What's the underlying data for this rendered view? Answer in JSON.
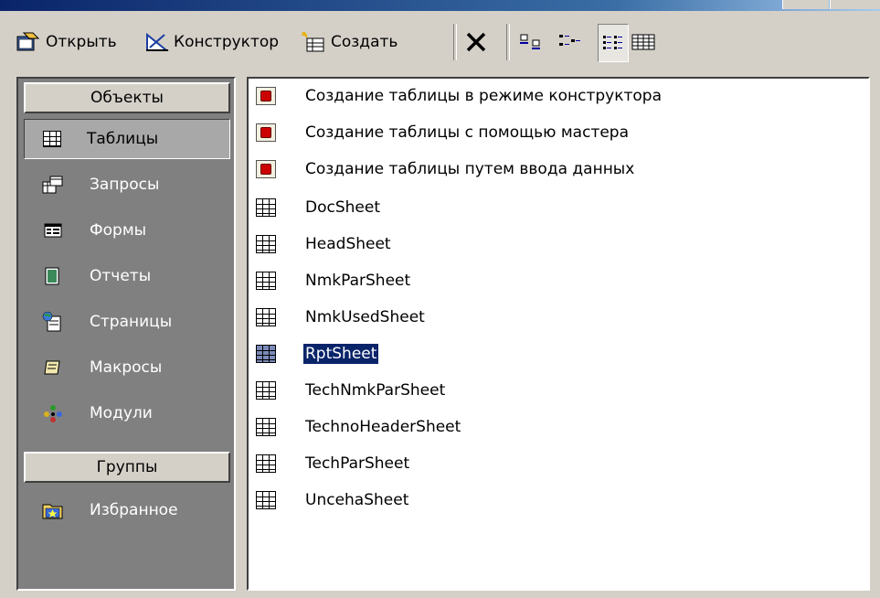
{
  "toolbar": {
    "open_label": "Открыть",
    "design_label": "Конструктор",
    "new_label": "Создать"
  },
  "objects_bar": {
    "objects_header": "Объекты",
    "items": [
      {
        "label": "Таблицы",
        "icon": "table-icon"
      },
      {
        "label": "Запросы",
        "icon": "query-icon"
      },
      {
        "label": "Формы",
        "icon": "form-icon"
      },
      {
        "label": "Отчеты",
        "icon": "report-icon"
      },
      {
        "label": "Страницы",
        "icon": "page-icon"
      },
      {
        "label": "Макросы",
        "icon": "macro-icon"
      },
      {
        "label": "Модули",
        "icon": "module-icon"
      }
    ],
    "groups_header": "Группы",
    "group_items": [
      {
        "label": "Избранное",
        "icon": "favorites-icon"
      }
    ]
  },
  "list": {
    "items": [
      {
        "label": "Создание таблицы в режиме конструктора",
        "icon": "shortcut-icon"
      },
      {
        "label": "Создание таблицы с помощью мастера",
        "icon": "shortcut-icon"
      },
      {
        "label": "Создание таблицы путем ввода данных",
        "icon": "shortcut-icon"
      },
      {
        "label": "DocSheet",
        "icon": "table-icon"
      },
      {
        "label": "HeadSheet",
        "icon": "table-icon"
      },
      {
        "label": "NmkParSheet",
        "icon": "table-icon"
      },
      {
        "label": "NmkUsedSheet",
        "icon": "table-icon"
      },
      {
        "label": "RptSheet",
        "icon": "table-icon"
      },
      {
        "label": "TechNmkParSheet",
        "icon": "table-icon"
      },
      {
        "label": "TechnoHeaderSheet",
        "icon": "table-icon"
      },
      {
        "label": "TechParSheet",
        "icon": "table-icon"
      },
      {
        "label": "UncehaSheet",
        "icon": "table-icon"
      }
    ],
    "selected": "RptSheet"
  },
  "colors": {
    "face": "#d4d0c8",
    "objbar": "#808080",
    "selection": "#0a246a"
  }
}
